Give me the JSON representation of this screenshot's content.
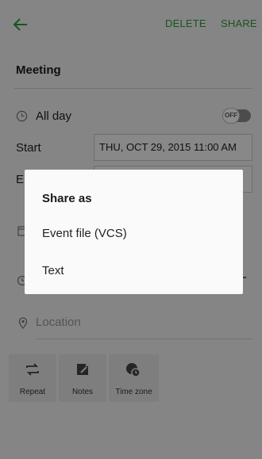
{
  "appbar": {
    "delete_label": "DELETE",
    "share_label": "SHARE",
    "back_icon": "back-arrow-icon",
    "accent_color": "#2f9a3a"
  },
  "event": {
    "title": "Meeting",
    "allday_label": "All day",
    "allday_toggle": "OFF",
    "start_label": "Start",
    "start_value": "THU, OCT 29, 2015   11:00 AM",
    "end_label": "En",
    "end_value_tail": "M",
    "location_placeholder": "Location"
  },
  "options": [
    {
      "label": "Repeat",
      "icon": "repeat-icon"
    },
    {
      "label": "Notes",
      "icon": "notes-icon"
    },
    {
      "label": "Time zone",
      "icon": "time-zone-icon"
    }
  ],
  "dialog": {
    "title": "Share as",
    "items": [
      "Event file (VCS)",
      "Text"
    ]
  }
}
